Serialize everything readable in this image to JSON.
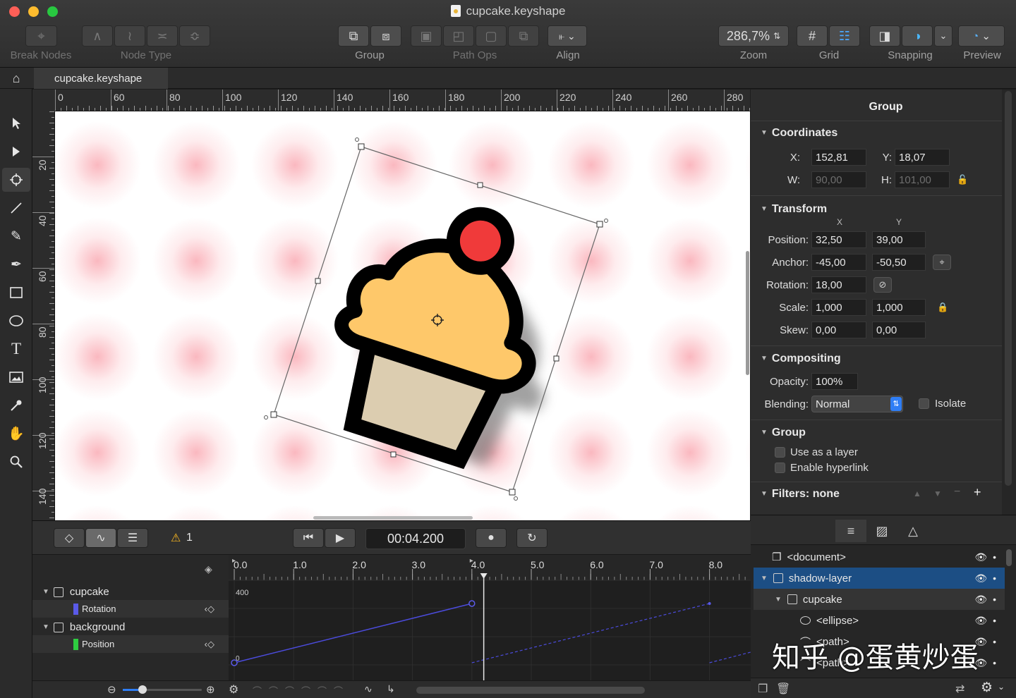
{
  "window": {
    "title": "cupcake.keyshape"
  },
  "toolbar": {
    "break_nodes": "Break Nodes",
    "node_type": "Node Type",
    "group": "Group",
    "path_ops": "Path Ops",
    "align": "Align",
    "zoom": "Zoom",
    "zoom_value": "286,7%",
    "grid": "Grid",
    "snapping": "Snapping",
    "preview": "Preview"
  },
  "tab": {
    "label": "cupcake.keyshape"
  },
  "tools": [
    "select-arrow",
    "direct-select-arrow",
    "anchor-crosshair",
    "line",
    "pencil",
    "pen",
    "rectangle",
    "ellipse",
    "text",
    "image",
    "eyedropper",
    "hand",
    "zoom"
  ],
  "ruler": {
    "top": [
      "0",
      "60",
      "80",
      "100",
      "120",
      "140",
      "160",
      "180",
      "200",
      "220",
      "240",
      "260",
      "280"
    ],
    "left": [
      "20",
      "40",
      "60",
      "80",
      "100",
      "120",
      "140"
    ]
  },
  "canvas": {
    "cupcake_colors": {
      "frosting": "#fec86a",
      "cherry": "#f03a3a",
      "cup": "#dccdb0",
      "outline": "#000000"
    }
  },
  "inspector": {
    "title": "Group",
    "coordinates": {
      "title": "Coordinates",
      "x_label": "X:",
      "x": "152,81",
      "y_label": "Y:",
      "y": "18,07",
      "w_label": "W:",
      "w": "90,00",
      "h_label": "H:",
      "h": "101,00"
    },
    "transform": {
      "title": "Transform",
      "col_x": "X",
      "col_y": "Y",
      "position_label": "Position:",
      "position_x": "32,50",
      "position_y": "39,00",
      "anchor_label": "Anchor:",
      "anchor_x": "-45,00",
      "anchor_y": "-50,50",
      "rotation_label": "Rotation:",
      "rotation": "18,00",
      "scale_label": "Scale:",
      "scale_x": "1,000",
      "scale_y": "1,000",
      "skew_label": "Skew:",
      "skew_x": "0,00",
      "skew_y": "0,00"
    },
    "compositing": {
      "title": "Compositing",
      "opacity_label": "Opacity:",
      "opacity": "100%",
      "blending_label": "Blending:",
      "blending": "Normal",
      "isolate": "Isolate"
    },
    "group": {
      "title": "Group",
      "use_as_layer": "Use as a layer",
      "enable_hyperlink": "Enable hyperlink"
    },
    "filters": {
      "title": "Filters: none"
    }
  },
  "layers": [
    {
      "name": "<document>",
      "indent": 0,
      "selected": false
    },
    {
      "name": "shadow-layer",
      "indent": 0,
      "selected": true
    },
    {
      "name": "cupcake",
      "indent": 1,
      "selected": false
    },
    {
      "name": "<ellipse>",
      "indent": 2,
      "selected": false
    },
    {
      "name": "<path>",
      "indent": 2,
      "selected": false
    },
    {
      "name": "<path>",
      "indent": 2,
      "selected": false
    }
  ],
  "timeline": {
    "warning_count": "1",
    "time": "00:04.200",
    "ticks": [
      "0.0",
      "1.0",
      "2.0",
      "3.0",
      "4.0",
      "5.0",
      "6.0",
      "7.0",
      "8.0"
    ],
    "graph_top_value": "400",
    "graph_bottom_value": "0",
    "tracks": [
      {
        "name": "cupcake",
        "type": "group"
      },
      {
        "name": "Rotation",
        "type": "property",
        "color": "#5a5ae8"
      },
      {
        "name": "background",
        "type": "group"
      },
      {
        "name": "Position",
        "type": "property",
        "color": "#2ecc40"
      }
    ]
  },
  "watermark": "知乎 @蛋黄炒蛋"
}
